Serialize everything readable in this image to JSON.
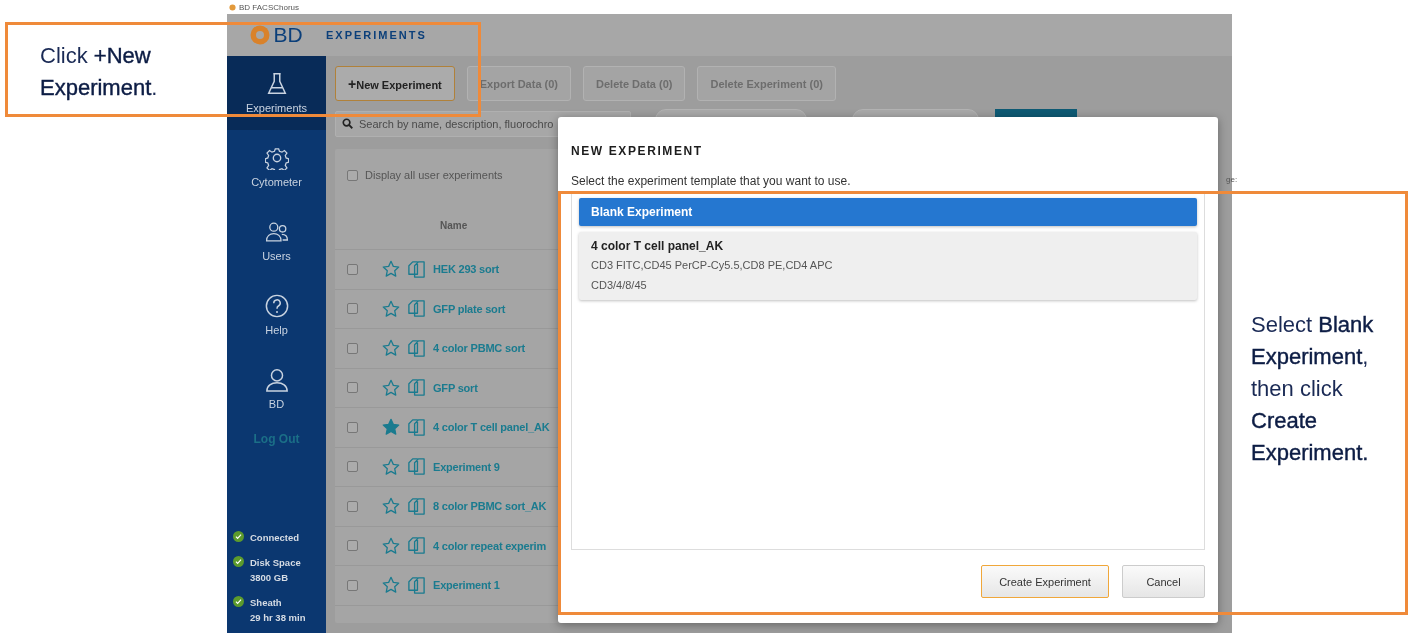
{
  "window": {
    "title": "BD FACSChorus"
  },
  "header": {
    "logo": "BD",
    "title": "EXPERIMENTS"
  },
  "sidebar": {
    "items": [
      {
        "label": "Experiments",
        "kind": "flask",
        "selected": true
      },
      {
        "label": "Cytometer",
        "kind": "gear",
        "selected": false
      },
      {
        "label": "Users",
        "kind": "users",
        "selected": false
      },
      {
        "label": "Help",
        "kind": "help",
        "selected": false
      },
      {
        "label": "BD",
        "kind": "user",
        "selected": false
      }
    ],
    "logout": "Log Out",
    "status": [
      {
        "label": "Connected"
      },
      {
        "label": "Disk Space",
        "detail": "3800 GB"
      },
      {
        "label": "Sheath",
        "detail": "29 hr 38 min"
      }
    ]
  },
  "toolbar": {
    "buttons": [
      {
        "label": "New Experiment",
        "icon": "+",
        "highlighted": true
      },
      {
        "label": "Export Data (0)",
        "highlighted": false
      },
      {
        "label": "Delete Data (0)",
        "highlighted": false
      },
      {
        "label": "Delete Experiment (0)",
        "highlighted": false
      }
    ]
  },
  "search": {
    "placeholder": "Search by name, description, fluorochro"
  },
  "filter": {
    "label": "Display all user experiments",
    "checked": false
  },
  "page_hint": "ge:",
  "table": {
    "columns": [
      "Name"
    ],
    "rows": [
      {
        "name": "HEK 293 sort",
        "checked": false,
        "favorite": false
      },
      {
        "name": "GFP plate sort",
        "checked": false,
        "favorite": false
      },
      {
        "name": "4 color PBMC sort",
        "checked": false,
        "favorite": false
      },
      {
        "name": "GFP sort",
        "checked": false,
        "favorite": false
      },
      {
        "name": "4 color T cell panel_AK",
        "checked": false,
        "favorite": true
      },
      {
        "name": "Experiment 9",
        "checked": false,
        "favorite": false
      },
      {
        "name": "8 color PBMC sort_AK",
        "checked": false,
        "favorite": false
      },
      {
        "name": "4 color repeat experim",
        "checked": false,
        "favorite": false
      },
      {
        "name": "Experiment 1",
        "checked": false,
        "favorite": false
      }
    ]
  },
  "modal": {
    "title": "NEW EXPERIMENT",
    "prompt": "Select the experiment template that you want to use.",
    "templates": [
      {
        "name": "Blank Experiment",
        "selected": true
      },
      {
        "name": "4 color T cell panel_AK",
        "lines": [
          "CD3 FITC,CD45 PerCP-Cy5.5,CD8 PE,CD4 APC",
          "CD3/4/8/45"
        ],
        "selected": false
      }
    ],
    "buttons": [
      {
        "label": "Create Experiment",
        "kind": "primary"
      },
      {
        "label": "Cancel",
        "kind": "secondary"
      }
    ]
  },
  "annotations": [
    {
      "text": "Click **+New Experiment**."
    },
    {
      "text": "Select **Blank Experiment**, then click **Create Experiment.**"
    }
  ]
}
